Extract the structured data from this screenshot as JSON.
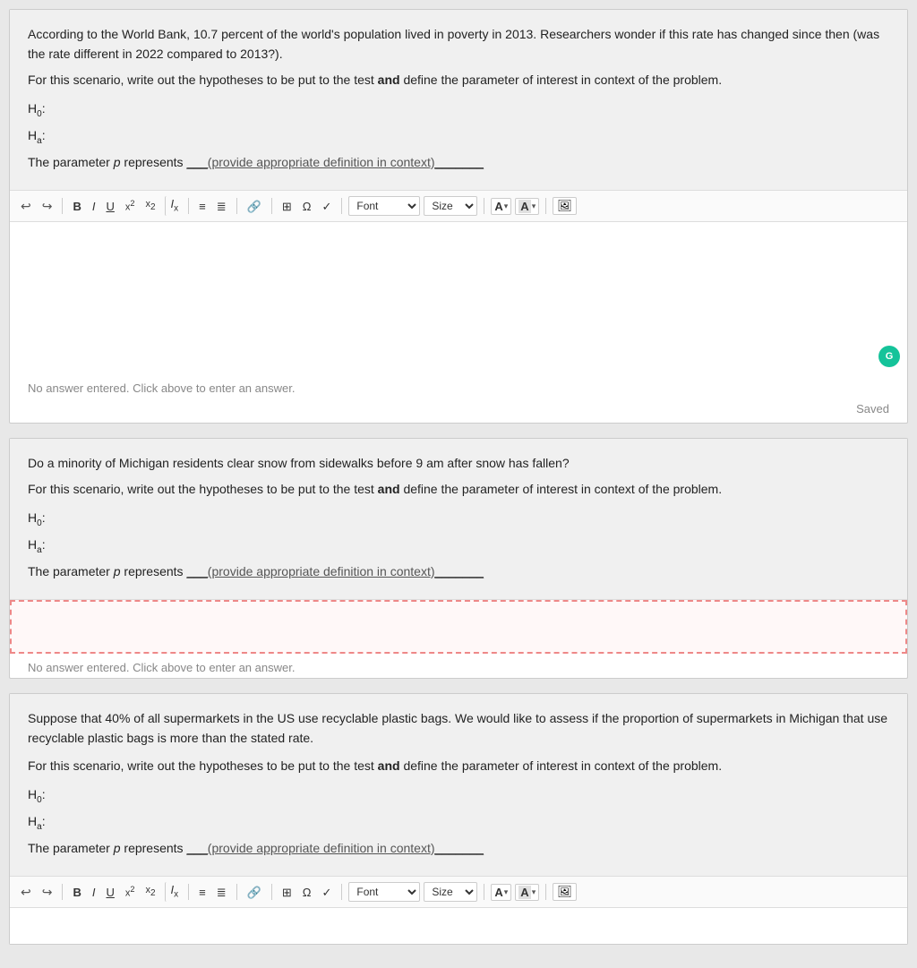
{
  "questions": [
    {
      "id": "q1",
      "prompt_lines": [
        "According to the World Bank, 10.7 percent of the world's population lived in poverty in 2013. Researchers wonder if this rate has changed since then (was the rate different in 2022 compared to 2013?).",
        "For this scenario, write out the hypotheses to be put to the test <strong>and</strong> define the parameter of interest in context of the problem."
      ],
      "h0_label": "H₀:",
      "ha_label": "Hₐ:",
      "param_text": "The parameter ",
      "param_italic": "p",
      "param_suffix": " represents ___(provide appropriate definition in context)_______",
      "has_editor": true,
      "has_top_editor": true,
      "editor_empty_text": "No answer entered. Click above to enter an answer.",
      "saved_text": "Saved",
      "show_grammarly": true
    },
    {
      "id": "q2",
      "prompt_lines": [
        "Do a minority of Michigan residents clear snow from sidewalks before 9 am after snow has fallen?",
        "For this scenario, write out the hypotheses to be put to the test <strong>and</strong> define the parameter of interest in context of the problem."
      ],
      "h0_label": "H₀:",
      "ha_label": "Hₐ:",
      "param_text": "The parameter ",
      "param_italic": "p",
      "param_suffix": " represents ___(provide appropriate definition in context)_______",
      "has_editor": true,
      "has_top_editor": false,
      "editor_empty_text": "No answer entered. Click above to enter an answer.",
      "saved_text": "",
      "show_grammarly": false,
      "editor_highlighted": true
    },
    {
      "id": "q3",
      "prompt_lines": [
        "Suppose that 40% of all supermarkets in the US use recyclable plastic bags. We would like to assess if the proportion of supermarkets in Michigan that use recyclable plastic bags is more than the stated rate.",
        "",
        "For this scenario, write out the hypotheses to be put to the test <strong>and</strong> define the parameter of interest in context of the problem."
      ],
      "h0_label": "H₀:",
      "ha_label": "Hₐ:",
      "param_text": "The parameter ",
      "param_italic": "p",
      "param_suffix": " represents ___(provide appropriate definition in context)_______",
      "has_editor": true,
      "has_top_editor": false,
      "has_bottom_editor": true,
      "editor_empty_text": "",
      "saved_text": "",
      "show_grammarly": false,
      "editor_highlighted": false
    }
  ],
  "toolbar": {
    "undo_label": "↩",
    "redo_label": "↪",
    "bold_label": "B",
    "italic_label": "I",
    "underline_label": "U",
    "superscript_label": "x²",
    "subscript_label": "x₂",
    "clear_format_label": "Ix",
    "ordered_list_label": "≡",
    "unordered_list_label": "≣",
    "link_label": "🔗",
    "table_label": "⊞",
    "omega_label": "Ω",
    "checkmark_label": "✓",
    "font_label": "Font",
    "size_label": "Size",
    "font_color_label": "A",
    "bg_color_label": "A",
    "image_label": "🖼"
  }
}
